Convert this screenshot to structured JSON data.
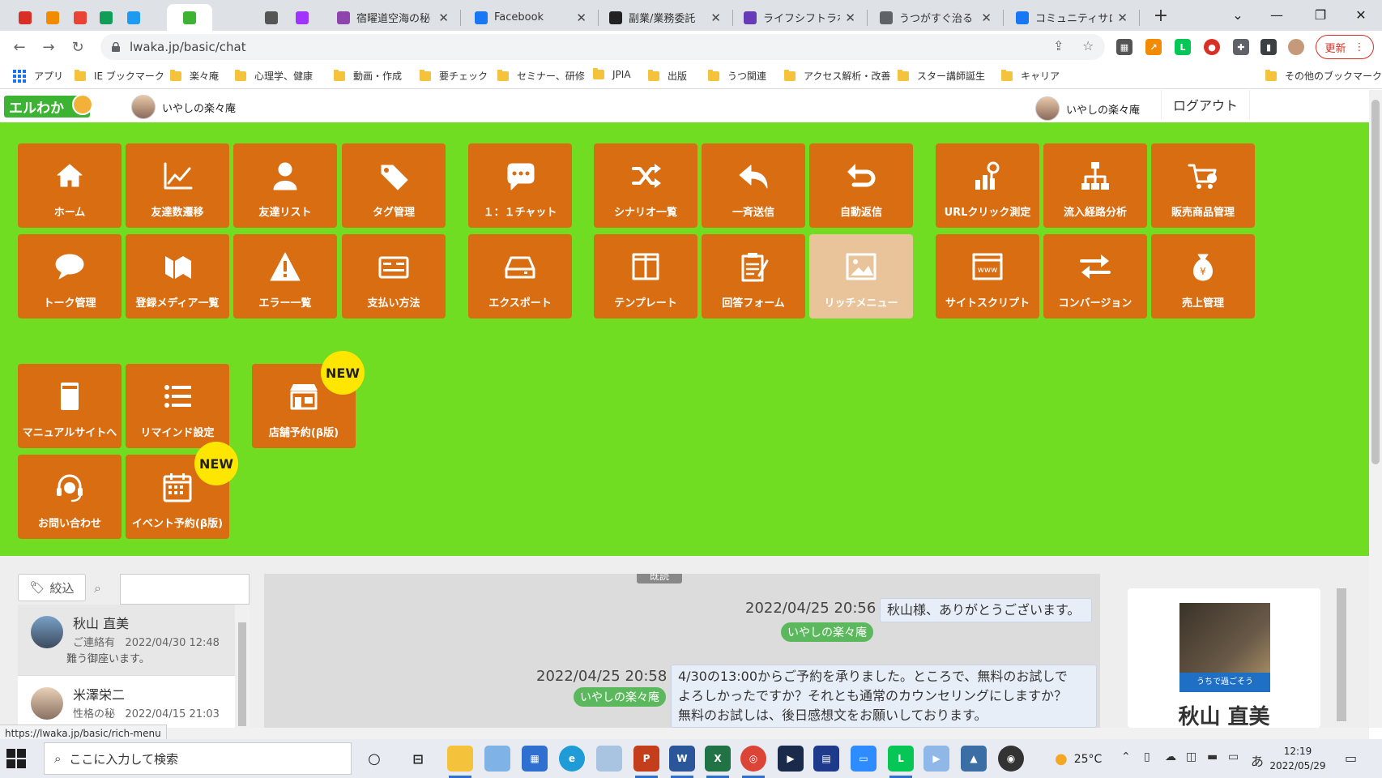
{
  "browser": {
    "tabs": [
      {
        "title": "",
        "favicon": "speedometer-icon",
        "color": "#d93025",
        "w": 0
      },
      {
        "title": "",
        "favicon": "seo-icon",
        "color": "#f28b00"
      },
      {
        "title": "",
        "favicon": "gmail-icon",
        "color": "#ea4335"
      },
      {
        "title": "",
        "favicon": "plus-icon",
        "color": "#0f9d58"
      },
      {
        "title": "",
        "favicon": "twitter-icon",
        "color": "#1d9bf0"
      },
      {
        "title": "",
        "favicon": "elwaka-icon",
        "color": "#3cb332"
      },
      {
        "title": "",
        "favicon": "blank-icon",
        "color": "#dee1e6"
      },
      {
        "title": "",
        "favicon": "info-icon",
        "color": "#555555"
      },
      {
        "title": "",
        "favicon": "messenger-icon",
        "color": "#a033ff"
      },
      {
        "title": "宿曜道空海の秘",
        "favicon": "u-icon",
        "color": "#8e44ad"
      },
      {
        "title": "Facebook",
        "favicon": "facebook-icon",
        "color": "#1877f2"
      },
      {
        "title": "副業/業務委託",
        "favicon": "notion-icon",
        "color": "#222222"
      },
      {
        "title": "ライフシフトラボキャ",
        "favicon": "forms-icon",
        "color": "#673ab7"
      },
      {
        "title": "うつがすぐ治る（ま",
        "favicon": "globe-icon",
        "color": "#5f6368"
      },
      {
        "title": "コミュニティサロン",
        "favicon": "facebook-icon",
        "color": "#1877f2"
      }
    ],
    "url": "lwaka.jp/basic/chat",
    "update_label": "更新",
    "status_url": "https://lwaka.jp/basic/rich-menu"
  },
  "bookmarks": {
    "apps_label": "アプリ",
    "items": [
      "IE ブックマーク",
      "楽々庵",
      "心理学、健康",
      "動画・作成",
      "要チェック",
      "セミナー、研修",
      "JPIA",
      "出版",
      "うつ関連",
      "アクセス解析・改善",
      "スター講師誕生",
      "キャリア"
    ],
    "other_label": "その他のブックマーク"
  },
  "header": {
    "logo_text": "エルわか",
    "account_left": "いやしの楽々庵",
    "account_right": "いやしの楽々庵",
    "logout_label": "ログアウト"
  },
  "menu": {
    "tiles": [
      {
        "label": "ホーム",
        "icon": "home-icon"
      },
      {
        "label": "友達数遷移",
        "icon": "chart-icon"
      },
      {
        "label": "友達リスト",
        "icon": "person-icon"
      },
      {
        "label": "タグ管理",
        "icon": "tag-icon"
      },
      {
        "label": "１：１チャット",
        "icon": "chat-icon"
      },
      {
        "label": "シナリオ一覧",
        "icon": "shuffle-icon"
      },
      {
        "label": "一斉送信",
        "icon": "reply-icon"
      },
      {
        "label": "自動返信",
        "icon": "undo-icon"
      },
      {
        "label": "URLクリック測定",
        "icon": "click-chart-icon"
      },
      {
        "label": "流入経路分析",
        "icon": "sitemap-icon"
      },
      {
        "label": "販売商品管理",
        "icon": "cart-icon"
      },
      {
        "label": "トーク管理",
        "icon": "speech-icon"
      },
      {
        "label": "登録メディア一覧",
        "icon": "media-icon"
      },
      {
        "label": "エラー一覧",
        "icon": "warning-icon"
      },
      {
        "label": "支払い方法",
        "icon": "card-icon"
      },
      {
        "label": "エクスポート",
        "icon": "drive-icon"
      },
      {
        "label": "テンプレート",
        "icon": "columns-icon"
      },
      {
        "label": "回答フォーム",
        "icon": "clipboard-icon"
      },
      {
        "label": "リッチメニュー",
        "icon": "image-icon",
        "disabled": true
      },
      {
        "label": "サイトスクリプト",
        "icon": "www-icon"
      },
      {
        "label": "コンバージョン",
        "icon": "exchange-icon"
      },
      {
        "label": "売上管理",
        "icon": "moneybag-icon"
      },
      {
        "label": "マニュアルサイトへ",
        "icon": "book-icon"
      },
      {
        "label": "リマインド設定",
        "icon": "list-icon"
      },
      {
        "label": "店舗予約(β版)",
        "icon": "store-icon",
        "badge": "NEW"
      },
      {
        "label": "お問い合わせ",
        "icon": "headset-icon"
      },
      {
        "label": "イベント予約(β版)",
        "icon": "calendar-icon",
        "badge": "NEW"
      }
    ]
  },
  "chat": {
    "filter_label": "絞込",
    "search_placeholder": "",
    "friends": [
      {
        "name": "秋山 直美",
        "status": "ご連絡有",
        "date": "2022/04/30 12:48",
        "snippet": "難う御座います。"
      },
      {
        "name": "米澤栄二",
        "status": "性格の秘",
        "date": "2022/04/15 21:03",
        "snippet": ""
      }
    ],
    "read_tag": "既読",
    "messages": [
      {
        "time": "2022/04/25 20:56",
        "text": "秋山様、ありがとうございます。",
        "sender": "いやしの楽々庵"
      },
      {
        "time": "2022/04/25 20:58",
        "text_lines": [
          "4/30の13:00からご予約を承りました。ところで、無料のお試しで",
          "よろしかったですか？それとも通常のカウンセリングにしますか？",
          "無料のお試しは、後日感想文をお願いしております。"
        ],
        "sender": "いやしの楽々庵"
      }
    ],
    "profile": {
      "name": "秋山 直美",
      "photo_caption": "うちで過ごそう"
    }
  },
  "taskbar": {
    "search_placeholder": "ここに入力して検索",
    "weather": "25°C",
    "ime": "あ",
    "time": "12:19",
    "date": "2022/05/29"
  }
}
